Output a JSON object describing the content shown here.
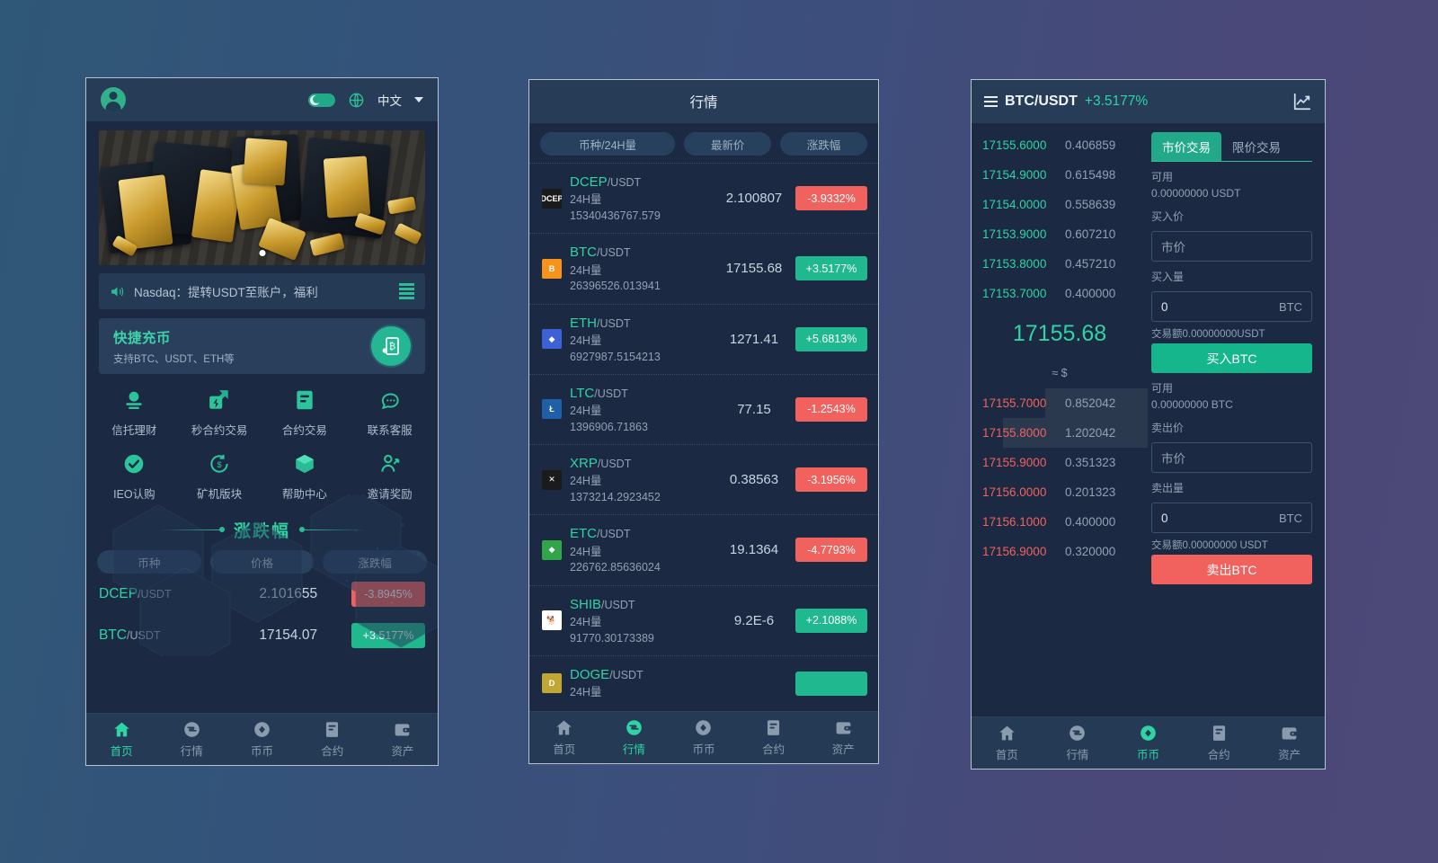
{
  "background": {
    "left_color": "#2f5777",
    "right_color": "#4c4979"
  },
  "panel_home": {
    "header": {
      "avatar_icon": "avatar-icon",
      "dark_mode_toggle_icon": "moon-toggle-icon",
      "globe_icon": "globe-icon",
      "language_label": "中文",
      "caret_icon": "chevron-down-icon"
    },
    "banner": {
      "indicator_icon": "carousel-dot"
    },
    "notice": {
      "speaker_icon": "speaker-icon",
      "text": "Nasdaq：提转USDT至账户，福利",
      "menu_icon": "list-menu-icon"
    },
    "recharge": {
      "title": "快捷充币",
      "subtitle": "支持BTC、USDT、ETH等",
      "icon": "bitcoin-deposit-icon"
    },
    "features": [
      {
        "label": "信托理财",
        "icon": "trust-finance-icon"
      },
      {
        "label": "秒合约交易",
        "icon": "second-contract-icon"
      },
      {
        "label": "合约交易",
        "icon": "contract-trade-icon"
      },
      {
        "label": "联系客服",
        "icon": "customer-service-icon"
      },
      {
        "label": "IEO认购",
        "icon": "ieo-check-icon"
      },
      {
        "label": "矿机版块",
        "icon": "miner-icon"
      },
      {
        "label": "帮助中心",
        "icon": "help-cube-icon"
      },
      {
        "label": "邀请奖励",
        "icon": "invite-reward-icon"
      }
    ],
    "change_section": {
      "title": "涨跌幅",
      "columns": [
        "币种",
        "价格",
        "涨跌幅"
      ],
      "rows": [
        {
          "base": "DCEP",
          "quote": "/USDT",
          "price": "2.101655",
          "change": "-3.8945%",
          "dir": "down"
        },
        {
          "base": "BTC",
          "quote": "/USDT",
          "price": "17154.07",
          "change": "+3.5177%",
          "dir": "up"
        }
      ]
    },
    "nav": [
      {
        "label": "首页",
        "icon": "home-icon",
        "active": true
      },
      {
        "label": "行情",
        "icon": "market-icon",
        "active": false
      },
      {
        "label": "币币",
        "icon": "coin-trade-icon",
        "active": false
      },
      {
        "label": "合约",
        "icon": "contract-icon",
        "active": false
      },
      {
        "label": "资产",
        "icon": "wallet-icon",
        "active": false
      }
    ]
  },
  "panel_market": {
    "title": "行情",
    "tabs": [
      {
        "label": "币种/24H量"
      },
      {
        "label": "最新价"
      },
      {
        "label": "涨跌幅"
      }
    ],
    "vol_label": "24H量",
    "rows": [
      {
        "base": "DCEP",
        "quote": "/USDT",
        "price": "2.100807",
        "volume": "15340436767.579",
        "change": "-3.9332%",
        "dir": "down",
        "icon": "dcep-coin-icon",
        "icon_bg": "#1a1a1a",
        "icon_fg": "#ffffff",
        "icon_text": "DCEP"
      },
      {
        "base": "BTC",
        "quote": "/USDT",
        "price": "17155.68",
        "volume": "26396526.013941",
        "change": "+3.5177%",
        "dir": "up",
        "icon": "btc-coin-icon",
        "icon_bg": "#f7931a",
        "icon_fg": "#ffffff",
        "icon_text": "B"
      },
      {
        "base": "ETH",
        "quote": "/USDT",
        "price": "1271.41",
        "volume": "6927987.5154213",
        "change": "+5.6813%",
        "dir": "up",
        "icon": "eth-coin-icon",
        "icon_bg": "#3c62d6",
        "icon_fg": "#ffffff",
        "icon_text": "◆"
      },
      {
        "base": "LTC",
        "quote": "/USDT",
        "price": "77.15",
        "volume": "1396906.71863",
        "change": "-1.2543%",
        "dir": "down",
        "icon": "ltc-coin-icon",
        "icon_bg": "#1f5fa8",
        "icon_fg": "#ffffff",
        "icon_text": "Ł"
      },
      {
        "base": "XRP",
        "quote": "/USDT",
        "price": "0.38563",
        "volume": "1373214.2923452",
        "change": "-3.1956%",
        "dir": "down",
        "icon": "xrp-coin-icon",
        "icon_bg": "#1b1b1b",
        "icon_fg": "#ffffff",
        "icon_text": "✕"
      },
      {
        "base": "ETC",
        "quote": "/USDT",
        "price": "19.1364",
        "volume": "226762.85636024",
        "change": "-4.7793%",
        "dir": "down",
        "icon": "etc-coin-icon",
        "icon_bg": "#30a54a",
        "icon_fg": "#ffffff",
        "icon_text": "◆"
      },
      {
        "base": "SHIB",
        "quote": "/USDT",
        "price": "9.2E-6",
        "volume": "91770.30173389",
        "change": "+2.1088%",
        "dir": "up",
        "icon": "shib-coin-icon",
        "icon_bg": "#ffffff",
        "icon_fg": "#e8600f",
        "icon_text": "🐕"
      },
      {
        "base": "DOGE",
        "quote": "/USDT",
        "price": "",
        "volume": "",
        "change": "",
        "dir": "up",
        "icon": "doge-coin-icon",
        "icon_bg": "#c2a633",
        "icon_fg": "#ffffff",
        "icon_text": "D"
      }
    ],
    "nav": [
      {
        "label": "首页",
        "icon": "home-icon",
        "active": false
      },
      {
        "label": "行情",
        "icon": "market-icon",
        "active": true
      },
      {
        "label": "币币",
        "icon": "coin-trade-icon",
        "active": false
      },
      {
        "label": "合约",
        "icon": "contract-icon",
        "active": false
      },
      {
        "label": "资产",
        "icon": "wallet-icon",
        "active": false
      }
    ]
  },
  "panel_trade": {
    "header": {
      "menu_icon": "hamburger-icon",
      "pair": "BTC/USDT",
      "change": "+3.5177%",
      "chart_icon": "line-chart-icon"
    },
    "orderbook": {
      "bids": [
        {
          "price": "17155.6000",
          "amount": "0.406859",
          "depth": 0
        },
        {
          "price": "17154.9000",
          "amount": "0.615498",
          "depth": 0
        },
        {
          "price": "17154.0000",
          "amount": "0.558639",
          "depth": 0
        },
        {
          "price": "17153.9000",
          "amount": "0.607210",
          "depth": 0
        },
        {
          "price": "17153.8000",
          "amount": "0.457210",
          "depth": 0
        },
        {
          "price": "17153.7000",
          "amount": "0.400000",
          "depth": 0
        }
      ],
      "last_price": "17155.68",
      "usd_approx": "≈ $",
      "asks": [
        {
          "price": "17155.7000",
          "amount": "0.852042",
          "depth": 58
        },
        {
          "price": "17155.8000",
          "amount": "1.202042",
          "depth": 82
        },
        {
          "price": "17155.9000",
          "amount": "0.351323",
          "depth": 0
        },
        {
          "price": "17156.0000",
          "amount": "0.201323",
          "depth": 0
        },
        {
          "price": "17156.1000",
          "amount": "0.400000",
          "depth": 0
        },
        {
          "price": "17156.9000",
          "amount": "0.320000",
          "depth": 0
        }
      ]
    },
    "form": {
      "tabs": [
        {
          "label": "市价交易",
          "active": true
        },
        {
          "label": "限价交易",
          "active": false
        }
      ],
      "buy": {
        "available_label": "可用",
        "available_value": "0.00000000 USDT",
        "price_label": "买入价",
        "price_placeholder": "市价",
        "amount_label": "买入量",
        "amount_value": "0",
        "amount_unit": "BTC",
        "total_note": "交易额0.00000000USDT",
        "button": "买入BTC"
      },
      "sell": {
        "available_label": "可用",
        "available_value": "0.00000000 BTC",
        "price_label": "卖出价",
        "price_placeholder": "市价",
        "amount_label": "卖出量",
        "amount_value": "0",
        "amount_unit": "BTC",
        "total_note": "交易额0.00000000 USDT",
        "button": "卖出BTC"
      }
    },
    "nav": [
      {
        "label": "首页",
        "icon": "home-icon",
        "active": false
      },
      {
        "label": "行情",
        "icon": "market-icon",
        "active": false
      },
      {
        "label": "币币",
        "icon": "coin-trade-icon",
        "active": true
      },
      {
        "label": "合约",
        "icon": "contract-icon",
        "active": false
      },
      {
        "label": "资产",
        "icon": "wallet-icon",
        "active": false
      }
    ]
  }
}
